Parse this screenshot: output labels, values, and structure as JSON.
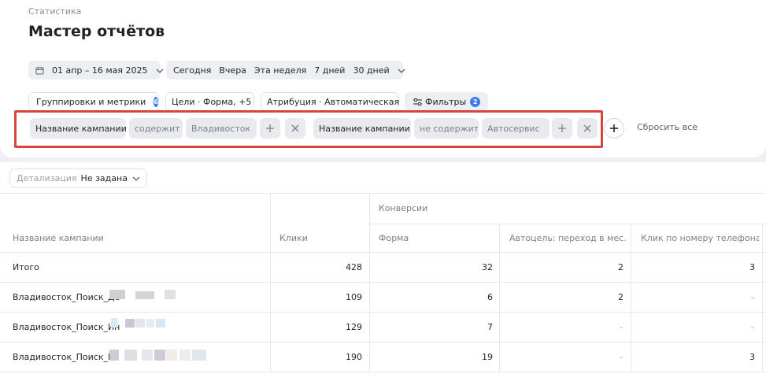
{
  "header": {
    "breadcrumb": "Статистика",
    "title": "Мастер отчётов"
  },
  "date_bar": {
    "range": "01 апр – 16 мая 2025",
    "presets": [
      "Сегодня",
      "Вчера",
      "Эта неделя",
      "7 дней",
      "30 дней"
    ]
  },
  "settings": {
    "grouping_label": "Группировки и метрики",
    "grouping_count": "6",
    "goals_label": "Цели · Форма, +5",
    "attribution_label": "Атрибуция · Автоматическая",
    "filters_label": "Фильтры",
    "filters_count": "2"
  },
  "filters": [
    {
      "field": "Название кампании",
      "operator": "содержит",
      "value": "Владивосток"
    },
    {
      "field": "Название кампании",
      "operator": "не содержит",
      "value": "Автосервис"
    }
  ],
  "reset_label": "Сбросить все",
  "detail": {
    "label": "Детализация",
    "value": "Не задана"
  },
  "table": {
    "group_header": "Конверсии",
    "columns": [
      "Название кампании",
      "Клики",
      "Форма",
      "Автоцель: переход в мес...",
      "Клик по номеру телефона"
    ],
    "rows": [
      {
        "name": "Итого",
        "clicks": "428",
        "form": "32",
        "autogoal": "2",
        "phone": "3"
      },
      {
        "name": "Владивосток_Поиск_Де",
        "clicks": "109",
        "form": "6",
        "autogoal": "2",
        "phone": "–"
      },
      {
        "name": "Владивосток_Поиск_Ин",
        "clicks": "129",
        "form": "7",
        "autogoal": "–",
        "phone": "–"
      },
      {
        "name": "Владивосток_Поиск_М",
        "clicks": "190",
        "form": "19",
        "autogoal": "–",
        "phone": "3"
      }
    ]
  },
  "colors": {
    "accent": "#3d7cf0",
    "annotation": "#d64541"
  }
}
